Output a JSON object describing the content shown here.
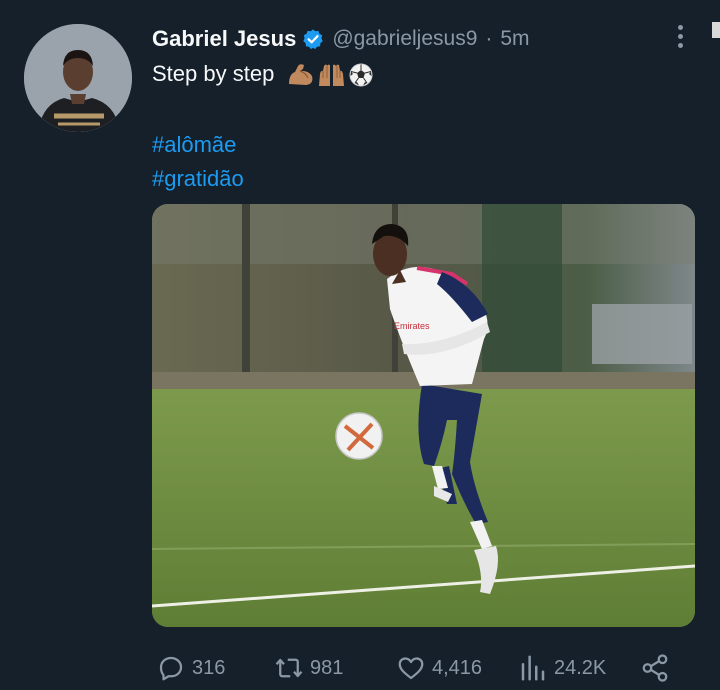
{
  "tweet": {
    "author": {
      "name": "Gabriel Jesus",
      "handle": "@gabrieljesus9",
      "verified": true
    },
    "separator": "·",
    "time": "5m",
    "text": "Step by step",
    "emoji": [
      "flexed-biceps",
      "raising-hands",
      "soccer-ball"
    ],
    "hashtags": [
      "#alômãe",
      "#gratidão"
    ],
    "stats": {
      "replies": "316",
      "retweets": "981",
      "likes": "4,416",
      "views": "24.2K"
    }
  },
  "colors": {
    "background": "#15202b",
    "text": "#f7f9f9",
    "secondary": "#8b98a5",
    "link": "#1d9bf0",
    "verified": "#1d9bf0"
  },
  "icons": [
    "more-icon",
    "verified-badge-icon",
    "reply-icon",
    "retweet-icon",
    "like-icon",
    "views-icon",
    "share-icon"
  ]
}
